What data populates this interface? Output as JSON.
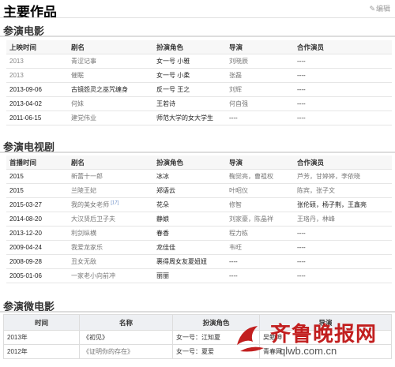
{
  "page": {
    "title": "主要作品",
    "edit_label": "编辑"
  },
  "film": {
    "section_title": "参演电影",
    "headers": [
      "上映时间",
      "剧名",
      "扮演角色",
      "导演",
      "合作演员"
    ],
    "rows": [
      [
        "2013",
        "青涩记事",
        "女一号 小雅",
        "刘晓辰",
        "----"
      ],
      [
        "2013",
        "催眠",
        "女一号 小柔",
        "张磊",
        "----"
      ],
      [
        "2013-09-06",
        "古镜怨灵之巫咒缠身",
        "反一号 王之",
        "刘辉",
        "----"
      ],
      [
        "2013-04-02",
        "何妹",
        "王若诗",
        "何自强",
        "----"
      ],
      [
        "2011-06-15",
        "建党伟业",
        "师范大学的女大学生",
        "----",
        "----"
      ]
    ]
  },
  "tv": {
    "section_title": "参演电视剧",
    "headers": [
      "首播时间",
      "剧名",
      "扮演角色",
      "导演",
      "合作演员"
    ],
    "rows": [
      [
        "2015",
        "新蕾十一郎",
        "冰冰",
        "鞠觉亮，曹祖权",
        "芦芳，甘婷婷，李依晓"
      ],
      [
        "2015",
        "兰陵王妃",
        "郑语云",
        "叶昭仪",
        "陈宾，张子文"
      ],
      [
        "2015-03-27",
        "我的美女老师",
        "花朵",
        "修智",
        "张伦硕，杨子荆，王鑫亮"
      ],
      [
        "2014-08-20",
        "大汉贤后卫子夫",
        "静娘",
        "刘家豪，陈晶祥",
        "王珞丹，林峰"
      ],
      [
        "2013-12-20",
        "利剑纵横",
        "春香",
        "程力栋",
        "----"
      ],
      [
        "2009-04-24",
        "我爱龙家乐",
        "龙佳佳",
        "韦旺",
        "----"
      ],
      [
        "2008-09-28",
        "丑女无敌",
        "裹得周女友夏妞妞",
        "----",
        "----"
      ],
      [
        "2005-01-06",
        "一家老小向前冲",
        "丽丽",
        "----",
        "----"
      ]
    ],
    "footnote": "[17]"
  },
  "micro": {
    "section_title": "参演微电影",
    "headers": [
      "时间",
      "名称",
      "扮演角色",
      "导演"
    ],
    "rows": [
      [
        "2013年",
        "《初见》",
        "女一号：江知夏",
        "吴勉坤"
      ],
      [
        "2012年",
        "《证明你的存在》",
        "女一号：夏爱",
        "青春网"
      ]
    ]
  },
  "watermark": {
    "text": "齐鲁晚报网",
    "url": "qlwb.com.cn"
  }
}
